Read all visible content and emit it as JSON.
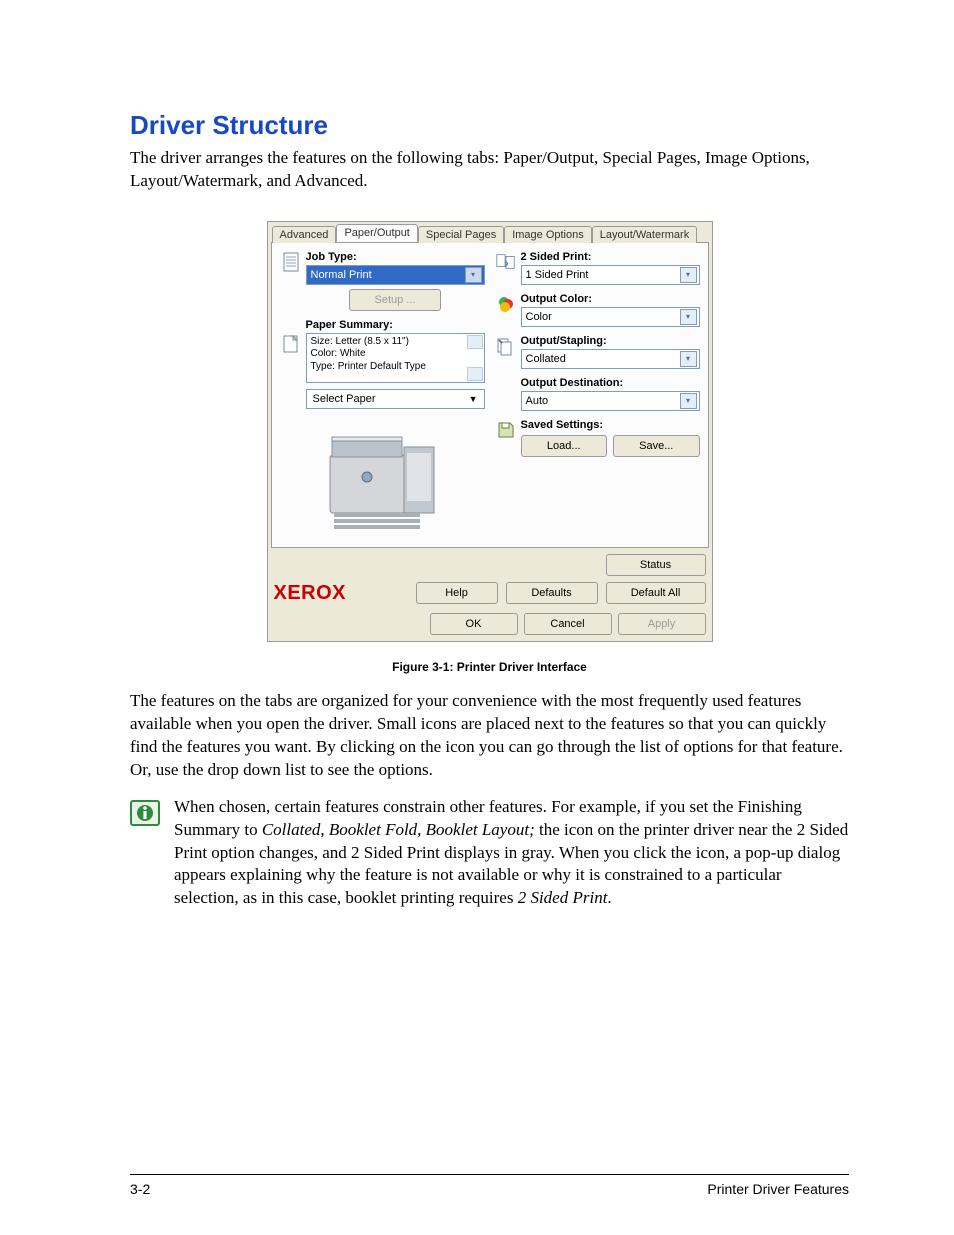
{
  "doc": {
    "heading": "Driver Structure",
    "intro": "The driver arranges the features on the following tabs: Paper/Output, Special Pages, Image Options, Layout/Watermark, and Advanced.",
    "figure_caption": "Figure 3-1:  Printer Driver Interface",
    "para2": " The features on the tabs are organized for your convenience with the most frequently used features available when you open the driver. Small icons are placed next to the features so that you can quickly find the features you want. By clicking on the icon you can go through the list of options for that feature. Or, use the drop down list to see the options.",
    "note_lead": "When chosen, certain features constrain other features. For example, if you set the Finishing Summary to ",
    "note_italic1": "Collated, Booklet Fold, Booklet Layout;",
    "note_mid": " the icon on the printer driver near the 2 Sided Print option changes, and 2 Sided Print displays in gray. When you click the icon, a pop-up dialog appears explaining why the feature is not available or why it is constrained to a particular selection, as in this case, booklet printing requires ",
    "note_italic2": "2 Sided Print",
    "note_end": ".",
    "footer_left": "3-2",
    "footer_right": "Printer Driver Features"
  },
  "driver": {
    "tabs": {
      "t0": "Advanced",
      "t1": "Paper/Output",
      "t2": "Special Pages",
      "t3": "Image Options",
      "t4": "Layout/Watermark"
    },
    "left": {
      "job_type_label": "Job Type:",
      "job_type_value": "Normal Print",
      "setup_btn": "Setup ...",
      "paper_summary_label": "Paper Summary:",
      "paper_summary_line1": "Size: Letter (8.5 x 11\")",
      "paper_summary_line2": "Color: White",
      "paper_summary_line3": "Type: Printer Default Type",
      "select_paper": "Select Paper"
    },
    "right": {
      "two_sided_label": "2 Sided Print:",
      "two_sided_value": "1 Sided Print",
      "output_color_label": "Output Color:",
      "output_color_value": "Color",
      "output_stapling_label": "Output/Stapling:",
      "output_stapling_value": "Collated",
      "output_dest_label": "Output Destination:",
      "output_dest_value": "Auto",
      "saved_label": "Saved Settings:",
      "load_btn": "Load...",
      "save_btn": "Save..."
    },
    "bottom": {
      "brand": "XEROX",
      "status_btn": "Status",
      "help_btn": "Help",
      "defaults_btn": "Defaults",
      "default_all_btn": "Default All",
      "ok_btn": "OK",
      "cancel_btn": "Cancel",
      "apply_btn": "Apply"
    }
  }
}
